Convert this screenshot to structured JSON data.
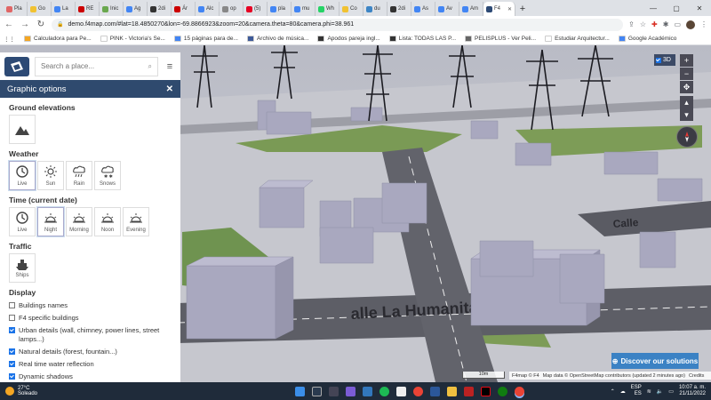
{
  "browser": {
    "tabs": [
      {
        "label": "Pla",
        "color": "#e06666"
      },
      {
        "label": "Go",
        "color": "#f1c232"
      },
      {
        "label": "La",
        "color": "#4285f4"
      },
      {
        "label": "RE",
        "color": "#cc0000"
      },
      {
        "label": "Inic",
        "color": "#6aa84f"
      },
      {
        "label": "Ag",
        "color": "#4285f4"
      },
      {
        "label": "2di",
        "color": "#333333"
      },
      {
        "label": "Ár",
        "color": "#cc0000"
      },
      {
        "label": "Alc",
        "color": "#4285f4"
      },
      {
        "label": "op",
        "color": "#888888"
      },
      {
        "label": "(5)",
        "color": "#e60023"
      },
      {
        "label": "pla",
        "color": "#4285f4"
      },
      {
        "label": "mu",
        "color": "#4285f4"
      },
      {
        "label": "Wh",
        "color": "#25d366"
      },
      {
        "label": "Co",
        "color": "#f1c232"
      },
      {
        "label": "du",
        "color": "#3d85c6"
      },
      {
        "label": "2di",
        "color": "#333333"
      },
      {
        "label": "As",
        "color": "#4285f4"
      },
      {
        "label": "Av",
        "color": "#4285f4"
      },
      {
        "label": "Am",
        "color": "#4285f4"
      },
      {
        "label": "F4",
        "color": "#2d4a75",
        "active": true
      }
    ],
    "url": "demo.f4map.com/#lat=18.4850270&lon=-69.8866923&zoom=20&camera.theta=80&camera.phi=38.961",
    "bookmarks": [
      {
        "label": "Calculadora para Pe...",
        "color": "#f4a623"
      },
      {
        "label": "PINK - Victoria's Se...",
        "color": "#ffffff"
      },
      {
        "label": "15 páginas para de...",
        "color": "#4285f4"
      },
      {
        "label": "Archivo de música...",
        "color": "#3d5a99"
      },
      {
        "label": "Apodos pareja ingl...",
        "color": "#333333"
      },
      {
        "label": "Lista: TODAS LAS P...",
        "color": "#333333"
      },
      {
        "label": "PELISPLUS - Ver Peli...",
        "color": "#666666"
      },
      {
        "label": "Estudiar Arquitectur...",
        "color": "#ffffff"
      },
      {
        "label": "Google Académico",
        "color": "#4285f4"
      }
    ]
  },
  "app": {
    "search_placeholder": "Search a place...",
    "panel_title": "Graphic options",
    "sections": {
      "ground": {
        "title": "Ground elevations"
      },
      "weather": {
        "title": "Weather",
        "options": [
          "Live",
          "Sun",
          "Rain",
          "Snows"
        ],
        "selected": 0
      },
      "time": {
        "title": "Time (current date)",
        "options": [
          "Live",
          "Night",
          "Morning",
          "Noon",
          "Evening"
        ],
        "selected": 1
      },
      "traffic": {
        "title": "Traffic",
        "options": [
          "Ships"
        ]
      },
      "display": {
        "title": "Display",
        "items": [
          {
            "label": "Buildings names",
            "checked": false
          },
          {
            "label": "F4 specific buildings",
            "checked": false
          },
          {
            "label": "Urban details (wall, chimney, power lines, street lamps...)",
            "checked": true
          },
          {
            "label": "Natural details (forest, fountain...)",
            "checked": true
          },
          {
            "label": "Real time water reflection",
            "checked": true
          },
          {
            "label": "Dynamic shadows",
            "checked": true
          }
        ]
      }
    },
    "map": {
      "btn_3d": "3D",
      "discover": "Discover our solutions",
      "scale": "10m",
      "attribution": {
        "brand": "F4map © F4",
        "data": "Map data © OpenStreetMap contributors (updated 2 minutes ago)",
        "credits": "Credits"
      },
      "street_name_1": "alle La Humanita",
      "street_name_2": "Calle"
    }
  },
  "taskbar": {
    "temp": "27°C",
    "condition": "Soleado",
    "lang_top": "ESP",
    "lang_bottom": "ES",
    "time": "10:07 a. m.",
    "date": "21/11/2022"
  }
}
